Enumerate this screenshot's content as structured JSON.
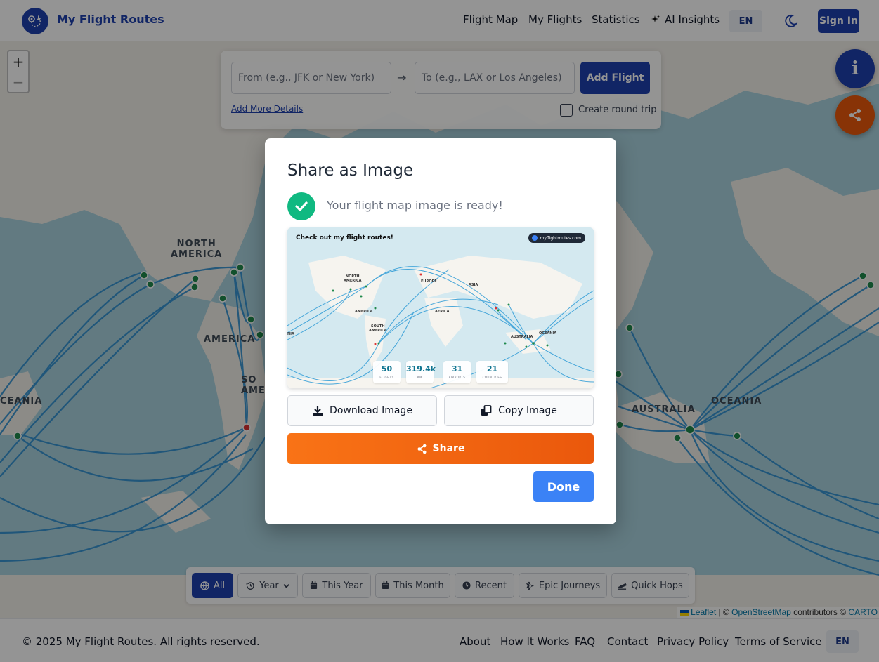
{
  "header": {
    "brand": "My Flight Routes",
    "nav": [
      "Flight Map",
      "My Flights",
      "Statistics",
      "AI Insights"
    ],
    "lang": "EN",
    "signin": "Sign In"
  },
  "map": {
    "labels": {
      "north_america": "NORTH\nAMERICA",
      "america": "AMERICA",
      "south_america": "SO\nAME",
      "oceania_left": "CEANIA",
      "australia": "AUSTRALIA",
      "oceania_right": "OCEANIA"
    },
    "zoom_in": "+",
    "zoom_out": "−",
    "search": {
      "from_placeholder": "From (e.g., JFK or New York)",
      "arrow": "→",
      "to_placeholder": "To (e.g., LAX or Los Angeles)",
      "add_flight": "Add Flight",
      "add_more_details": "Add More Details",
      "round_trip": "Create round trip"
    },
    "fab_info": "i",
    "filters": [
      "All",
      "Year",
      "This Year",
      "This Month",
      "Recent",
      "Epic Journeys",
      "Quick Hops"
    ],
    "attribution": {
      "leaflet": "Leaflet",
      "sep": "| ©",
      "osm": "OpenStreetMap",
      "contributors": "contributors ©",
      "carto": "CARTO"
    },
    "colors": {
      "route": "#2b8fd1",
      "airport": "#1f8a4c",
      "airport_red": "#d33"
    }
  },
  "modal": {
    "title": "Share as Image",
    "ready": "Your flight map image is ready!",
    "preview": {
      "heading": "Check out my flight routes!",
      "badge": "myflightroutes.com",
      "labels": {
        "north_america": "NORTH\nAMERICA",
        "europe": "EUROPE",
        "asia": "ASIA",
        "america": "AMERICA",
        "africa": "AFRICA",
        "south_america": "SOUTH\nAMERICA",
        "australia": "AUSTRALIA",
        "oceania": "OCEANIA",
        "edge": "NIA"
      },
      "stats": [
        {
          "value": "50",
          "label": "FLIGHTS"
        },
        {
          "value": "319.4k",
          "label": "KM"
        },
        {
          "value": "31",
          "label": "AIRPORTS"
        },
        {
          "value": "21",
          "label": "COUNTRIES"
        }
      ]
    },
    "download": "Download Image",
    "copy": "Copy Image",
    "share": "Share",
    "done": "Done"
  },
  "footer": {
    "copyright": "© 2025 My Flight Routes. All rights reserved.",
    "links": [
      "About",
      "How It Works",
      "FAQ",
      "Contact",
      "Privacy Policy",
      "Terms of Service"
    ],
    "lang": "EN"
  }
}
